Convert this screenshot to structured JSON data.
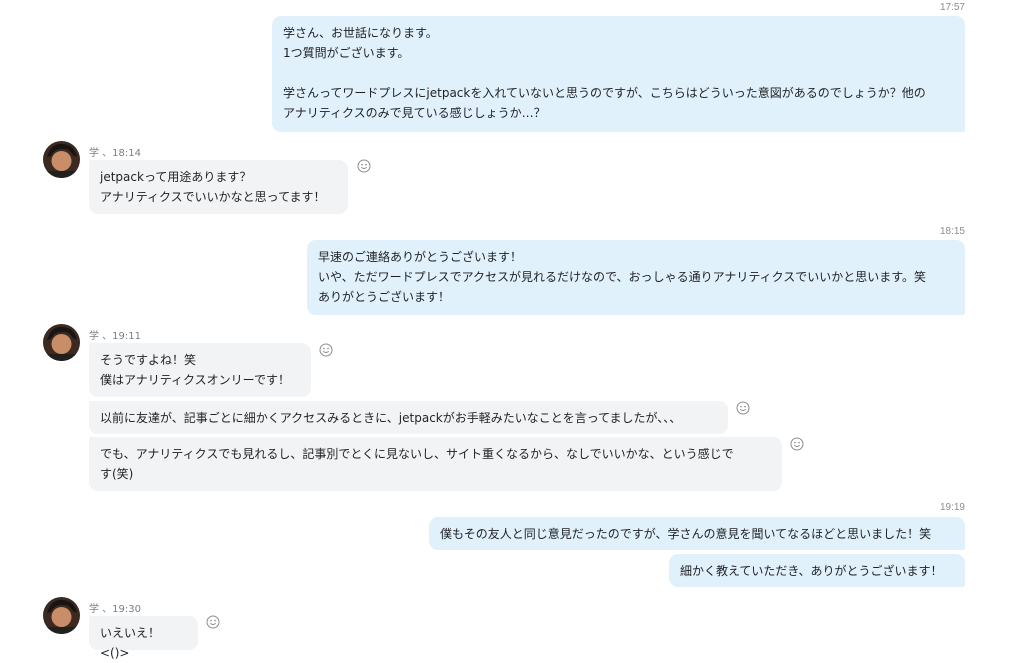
{
  "messages": {
    "m1_time": "17:57",
    "m1_text": "学さん、お世話になります。\n1つ質問がございます。\n\n学さんってワードプレスにjetpackを入れていないと思うのですが、こちらはどういった意図があるのでしょうか？他の\nアナリティクスのみで見ている感じしょうか…？",
    "m2_sender": "学 、18:14",
    "m2_text": "jetpackって用途あります？\nアナリティクスでいいかなと思ってます！",
    "m3_time": "18:15",
    "m3_text": "早速のご連絡ありがとうございます！\nいや、ただワードプレスでアクセスが見れるだけなので、おっしゃる通りアナリティクスでいいかと思います。笑\nありがとうございます！",
    "m4_sender": "学 、19:11",
    "m4_text": "そうですよね！笑\n僕はアナリティクスオンリーです！",
    "m5_text": "以前に友達が、記事ごとに細かくアクセスみるときに、jetpackがお手軽みたいなことを言ってましたが、、、",
    "m6_text": "でも、アナリティクスでも見れるし、記事別でとくに見ないし、サイト重くなるから、なしでいいかな、という感じで\nす(笑)",
    "m7_time": "19:19",
    "m7_text": "僕もその友人と同じ意見だったのですが、学さんの意見を聞いてなるほどと思いました！笑",
    "m8_text": "細かく教えていただき、ありがとうございます！",
    "m9_sender": "学 、19:30",
    "m9_text": "いえいえ！<()>"
  },
  "icons": {
    "reaction": "smiley-icon",
    "avatar": "avatar"
  },
  "colors": {
    "outgoing_bubble": "#e0f1fb",
    "incoming_bubble": "#f1f3f5"
  }
}
